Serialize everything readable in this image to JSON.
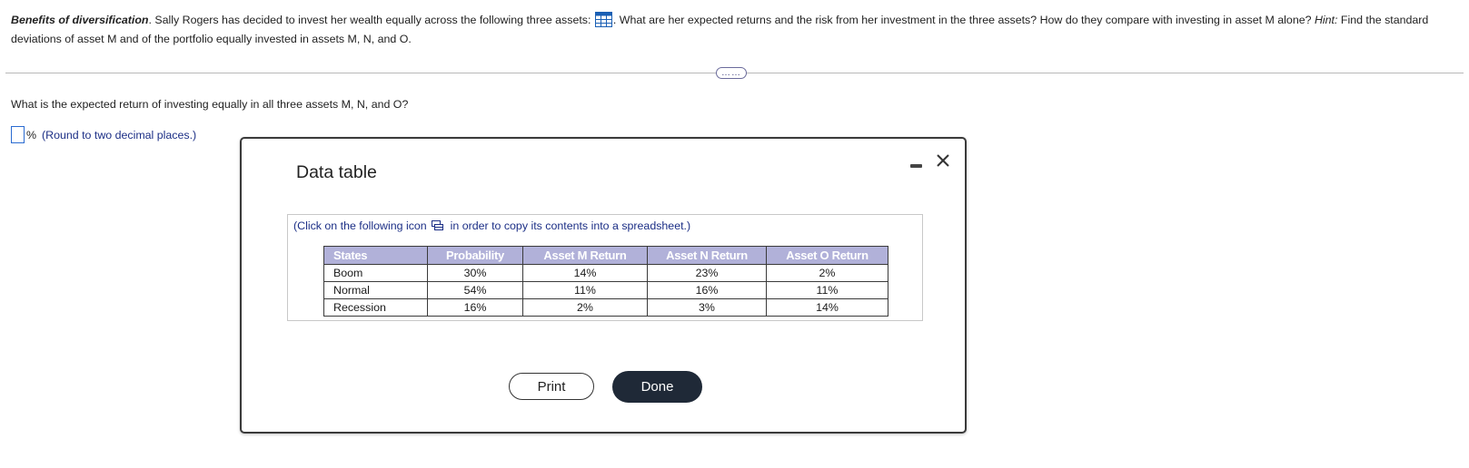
{
  "problem": {
    "title": "Benefits of diversification",
    "text_before_icon": ". Sally Rogers has decided to invest her wealth equally across the following three assets:",
    "text_after_icon": ". What are her expected returns and the risk from her investment in the three assets? How do they compare with investing in asset M alone?",
    "hint_label": "Hint:",
    "hint_text": "Find the standard deviations of asset M and of the portfolio equally invested in assets M, N, and O."
  },
  "more_button_label": "……",
  "question": {
    "text": "What is the expected return of investing equally in all three assets M, N, and O?",
    "answer_value": "",
    "unit": "%",
    "instruction": "(Round to two decimal places.)"
  },
  "modal": {
    "title": "Data table",
    "note_before_icon": "(Click on the following icon",
    "note_after_icon": "in order to copy its contents into a spreadsheet.)",
    "table": {
      "headers": [
        "States",
        "Probability",
        "Asset M Return",
        "Asset N Return",
        "Asset O Return"
      ],
      "rows": [
        [
          "Boom",
          "30%",
          "14%",
          "23%",
          "2%"
        ],
        [
          "Normal",
          "54%",
          "11%",
          "16%",
          "11%"
        ],
        [
          "Recession",
          "16%",
          "2%",
          "3%",
          "14%"
        ]
      ]
    },
    "print_label": "Print",
    "done_label": "Done"
  },
  "colors": {
    "table_header_bg": "#b1b1d9",
    "link_text": "#1c2f86",
    "done_button_bg": "#1f2937",
    "answer_border": "#2a6bd1"
  },
  "icons": [
    "data-table-grid-icon",
    "copy-to-spreadsheet-icon",
    "minimize-icon",
    "close-icon"
  ]
}
